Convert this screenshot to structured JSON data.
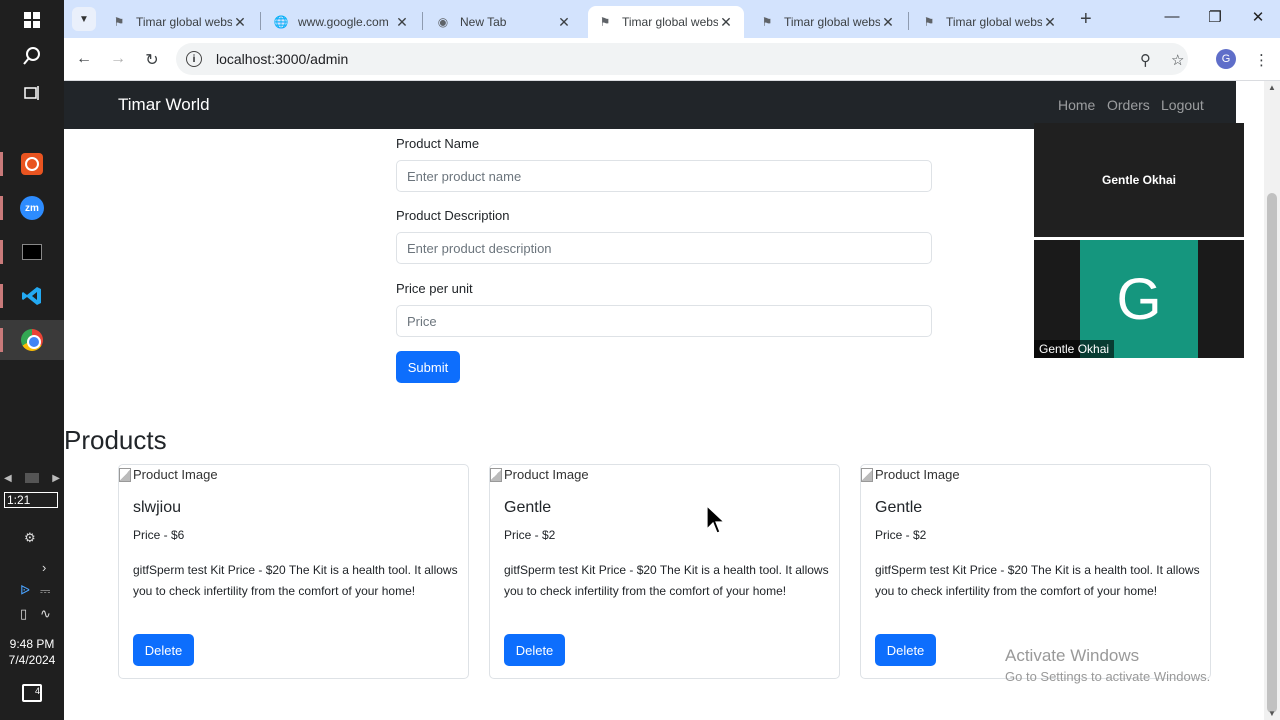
{
  "taskbar": {
    "apps": [
      "windows-start",
      "search",
      "task-view",
      "ubuntu",
      "zoom",
      "terminal",
      "vscode",
      "chrome"
    ],
    "zoom_label": "zm",
    "battery_time": "1:21",
    "clock_time": "9:48 PM",
    "clock_date": "7/4/2024",
    "notification_count": "4"
  },
  "browser": {
    "tabs": [
      {
        "title": "Timar global website",
        "icon": "page-icon",
        "active": false
      },
      {
        "title": "www.google.com",
        "icon": "globe-icon",
        "active": false
      },
      {
        "title": "New Tab",
        "icon": "chrome-icon",
        "active": false
      },
      {
        "title": "Timar global website",
        "icon": "page-icon",
        "active": true
      },
      {
        "title": "Timar global website",
        "icon": "page-icon",
        "active": false
      },
      {
        "title": "Timar global website",
        "icon": "page-icon",
        "active": false
      }
    ],
    "url": "localhost:3000/admin",
    "profile_initial": "G"
  },
  "site": {
    "brand": "Timar World",
    "nav": {
      "home": "Home",
      "orders": "Orders",
      "logout": "Logout"
    },
    "form": {
      "name_label": "Product Name",
      "name_placeholder": "Enter product name",
      "desc_label": "Product Description",
      "desc_placeholder": "Enter product description",
      "price_label": "Price per unit",
      "price_placeholder": "Price",
      "submit_label": "Submit"
    },
    "products_heading": "Products",
    "products": [
      {
        "image_alt": "Product Image",
        "title": "slwjiou",
        "price": "Price - $6",
        "description": "gitfSperm test Kit Price - $20 The Kit is a health tool. It allows you to check infertility from the comfort of your home!",
        "delete_label": "Delete"
      },
      {
        "image_alt": "Product Image",
        "title": "Gentle",
        "price": "Price - $2",
        "description": "gitfSperm test Kit Price - $20 The Kit is a health tool. It allows you to check infertility from the comfort of your home!",
        "delete_label": "Delete"
      },
      {
        "image_alt": "Product Image",
        "title": "Gentle",
        "price": "Price - $2",
        "description": "gitfSperm test Kit Price - $20 The Kit is a health tool. It allows you to check infertility from the comfort of your home!",
        "delete_label": "Delete"
      }
    ]
  },
  "video_call": {
    "speaker_name": "Gentle Okhai",
    "participant_initial": "G",
    "participant_name": "Gentle Okhai"
  },
  "watermark": {
    "line1": "Activate Windows",
    "line2": "Go to Settings to activate Windows."
  },
  "colors": {
    "primary": "#0d6efd",
    "navbar": "#212529",
    "tabstrip": "#d3e3fd",
    "avatar_bg": "#15967e"
  }
}
